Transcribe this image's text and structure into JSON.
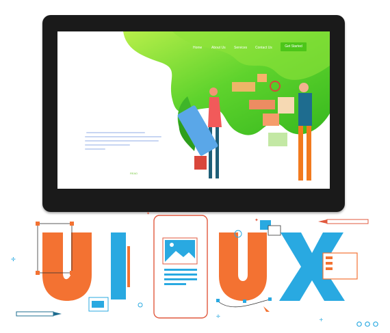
{
  "screen": {
    "nav": [
      "Home",
      "About Us",
      "Services",
      "Contact Us"
    ],
    "cta_label": "Get Started",
    "more_link": "READ"
  },
  "artwork": {
    "left_word": "UI",
    "right_word": "UX"
  },
  "colors": {
    "green": "#4cc619",
    "orange": "#f37232",
    "blue": "#29a9e1",
    "monitor": "#1a1a1a"
  },
  "icons": [
    "image-icon",
    "pencil-icon",
    "more-dots-icon",
    "person-icon",
    "plant-icon"
  ]
}
